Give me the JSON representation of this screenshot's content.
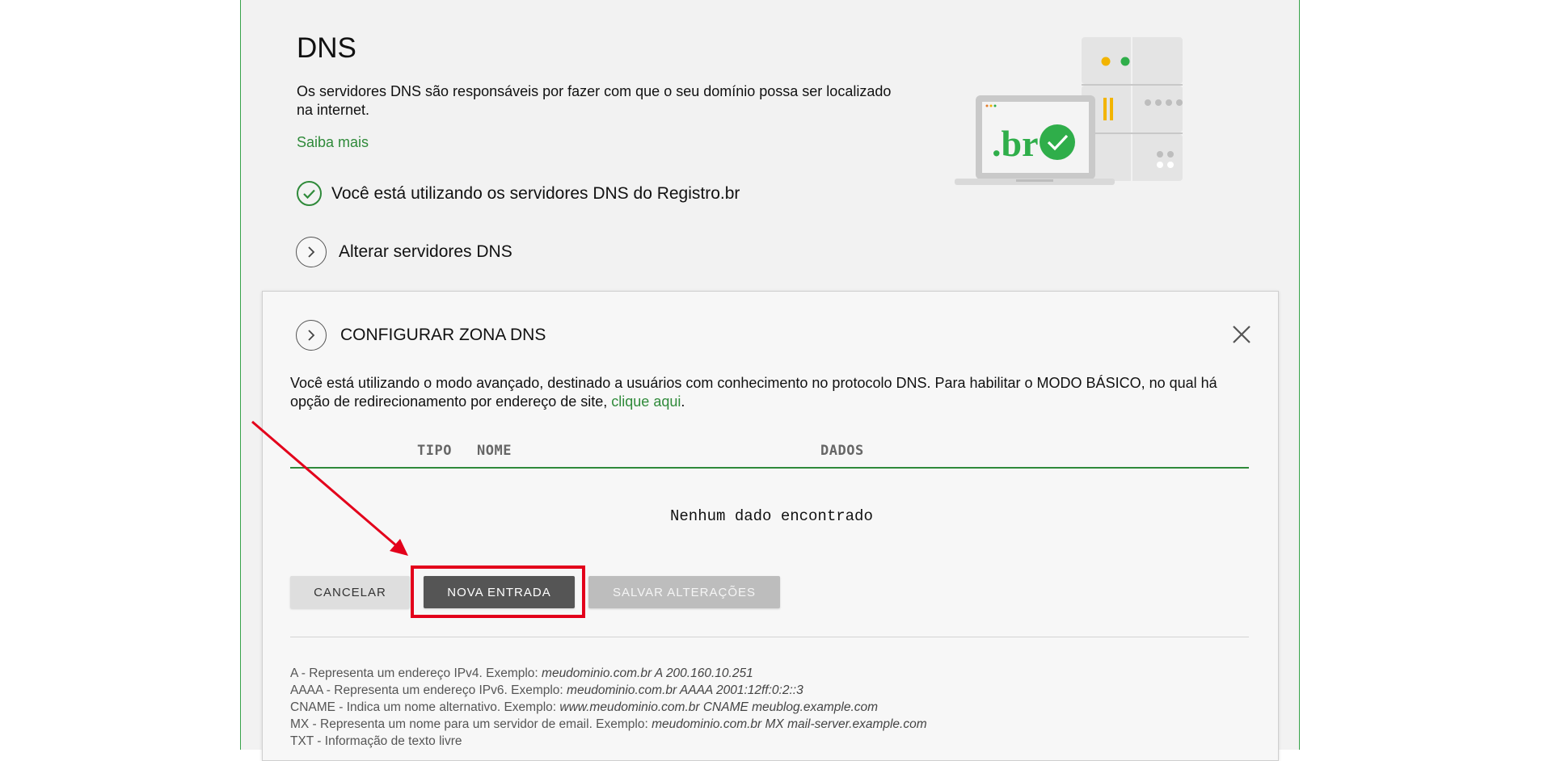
{
  "dns": {
    "title": "DNS",
    "description": "Os servidores DNS são responsáveis por fazer com que o seu domínio possa ser localizado na internet.",
    "learn_more": "Saiba mais",
    "status": "Você está utilizando os servidores DNS do Registro.br",
    "change_servers": "Alterar servidores DNS",
    "illustration_text": ".br"
  },
  "zone": {
    "title": "CONFIGURAR ZONA DNS",
    "mode_text": "Você está utilizando o modo avançado, destinado a usuários com conhecimento no protocolo DNS. Para habilitar o MODO BÁSICO, no qual há opção de redirecionamento por endereço de site,",
    "mode_link": "clique aqui",
    "mode_suffix": ".",
    "columns": {
      "tipo": "TIPO",
      "nome": "NOME",
      "dados": "DADOS"
    },
    "empty_message": "Nenhum dado encontrado",
    "buttons": {
      "cancel": "CANCELAR",
      "new_entry": "NOVA ENTRADA",
      "save": "SALVAR ALTERAÇÕES"
    },
    "help": [
      {
        "label": "A - Representa um endereço IPv4. Exemplo: ",
        "example": "meudominio.com.br A 200.160.10.251"
      },
      {
        "label": "AAAA - Representa um endereço IPv6. Exemplo: ",
        "example": "meudominio.com.br AAAA 2001:12ff:0:2::3"
      },
      {
        "label": "CNAME - Indica um nome alternativo. Exemplo: ",
        "example": "www.meudominio.com.br CNAME meublog.example.com"
      },
      {
        "label": "MX - Representa um nome para um servidor de email. Exemplo: ",
        "example": "meudominio.com.br MX mail-server.example.com"
      },
      {
        "label": "TXT - Informação de texto livre",
        "example": ""
      }
    ]
  },
  "colors": {
    "accent_green": "#2f8a3a",
    "highlight_red": "#e3001b",
    "primary_button": "#555555"
  }
}
